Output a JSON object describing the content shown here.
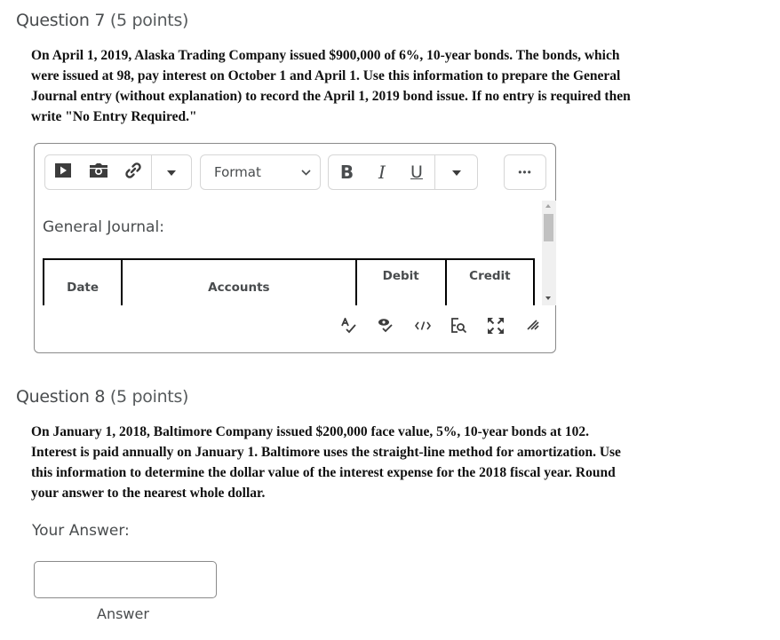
{
  "question7": {
    "title": "Question 7",
    "points": "(5 points)",
    "text_lines": [
      "On April 1, 2019, Alaska Trading Company issued $900,000 of 6%, 10-year bonds.  The bonds, which",
      "were issued at 98, pay interest on October 1 and April 1. Use this information to prepare the General",
      "Journal entry (without explanation) to record the April 1, 2019 bond issue. If no entry is required then",
      "write \"No Entry Required.\""
    ],
    "editor": {
      "toolbar": {
        "insert_group": [
          {
            "icon": "video-icon"
          },
          {
            "icon": "camera-icon"
          },
          {
            "icon": "link-icon"
          },
          {
            "icon": "caret-down-icon"
          }
        ],
        "format_label": "Format",
        "style_group": [
          {
            "label": "B",
            "icon": "bold-icon"
          },
          {
            "label": "I",
            "icon": "italic-icon"
          },
          {
            "label": "U",
            "icon": "underline-icon"
          },
          {
            "icon": "caret-down-icon"
          }
        ],
        "more_label": "•••"
      },
      "content": {
        "heading": "General Journal:",
        "table_headers": [
          "Date",
          "Accounts",
          "Debit",
          "Credit"
        ]
      },
      "bottom_icons": [
        "spellcheck-icon",
        "accessibility-check-icon",
        "source-code-icon",
        "find-replace-icon",
        "fullscreen-icon",
        "resize-handle-icon"
      ]
    }
  },
  "question8": {
    "title": "Question 8",
    "points": "(5 points)",
    "text_lines": [
      "On January 1, 2018, Baltimore Company issued $200,000 face value, 5%, 10-year bonds at 102.",
      "Interest is paid annually on January 1.  Baltimore uses the straight-line method for amortization. Use",
      "this information to determine the dollar value of the interest expense for the 2018 fiscal year. Round",
      "your answer to the nearest whole dollar."
    ],
    "answer_label": "Your Answer:",
    "answer_value": "",
    "answer_caption": "Answer"
  }
}
